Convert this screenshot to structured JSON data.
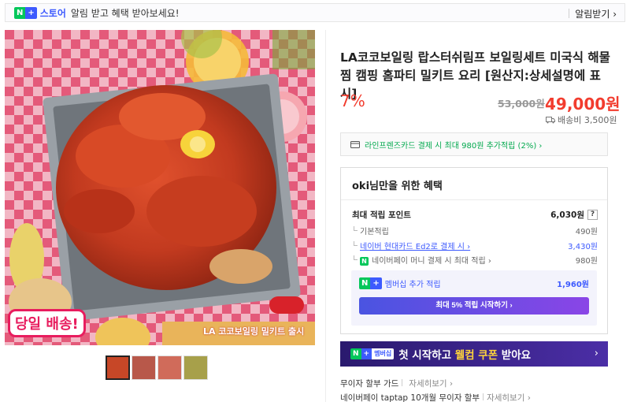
{
  "notice": {
    "badge_n": "N",
    "badge_plus": "+",
    "store_label": "스토어",
    "text": "알림 받고 혜택 받아보세요!",
    "alarm_button": "알림받기 ›"
  },
  "product": {
    "title": "LA코코보일링 랍스터쉬림프 보일링세트 미국식 해물찜 캠핑 홈파티 밀키트 요리 [원산지:상세설명에 표시]",
    "discount": "7%",
    "original_price": "53,000원",
    "sale_price": "49,000원",
    "shipping": "배송비 3,500원",
    "image_caption_left": "당일 배송!",
    "image_caption_right": "LA 코코보일링 밀키트 출시",
    "thumbnail_count": 4
  },
  "card_offer": {
    "text": "라인프렌즈카드 결제 시 최대 980원 추가적립 (2%) ›"
  },
  "benefit": {
    "title": "oki님만을 위한 혜택",
    "max_points_label": "최대 적립 포인트",
    "max_points_value": "6,030원",
    "help": "?",
    "rows": [
      {
        "label": "기본적립",
        "value": "490원"
      },
      {
        "label": "네이버 현대카드 Ed2로 결제 시 ›",
        "value": "3,430원"
      },
      {
        "label": "네이버페이 머니 결제 시 최대 적립 ›",
        "value": "980원"
      }
    ],
    "membership_label": "멤버십 추가 적립",
    "membership_value": "1,960원",
    "start_button": "최대 5% 적립 시작하기 ›"
  },
  "promo": {
    "badge_n": "N",
    "badge_plus": "+",
    "badge_member": "멤버십",
    "text_a": "첫 시작하고 ",
    "text_hl": "웰컴 쿠폰",
    "text_b": " 받아요",
    "arrow": "›"
  },
  "guide": {
    "row1_label": "무이자 할부 가드",
    "row1_more": "자세히보기 ›",
    "row2_label": "네이버페이 taptap 10개월 무이자 할부",
    "row2_more": "자세히보기 ›"
  },
  "colors": {
    "accent_red": "#f23c2e",
    "naver_green": "#03c75a",
    "brand_blue": "#3d5afe",
    "promo_purple": "#2a1a6e"
  }
}
